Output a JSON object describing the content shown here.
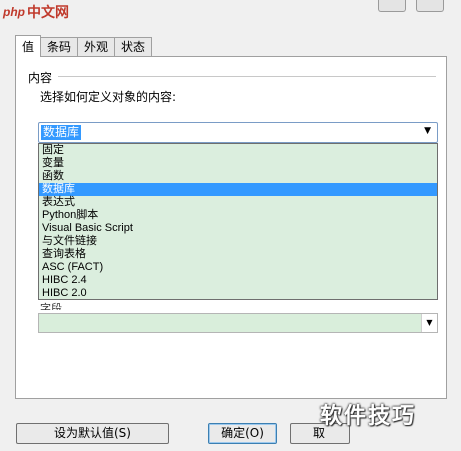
{
  "watermark_top": {
    "php": "php",
    "cn": "中文网"
  },
  "tabs": [
    {
      "label": "值"
    },
    {
      "label": "条码"
    },
    {
      "label": "外观"
    },
    {
      "label": "状态"
    }
  ],
  "content_group": {
    "title": "内容",
    "prompt": "选择如何定义对象的内容:",
    "selected": "数据库"
  },
  "dropdown_options": [
    "固定",
    "变量",
    "函数",
    "数据库",
    "表达式",
    "Python脚本",
    "Visual Basic Script",
    "与文件链接",
    "查询表格",
    "ASC (FACT)",
    "HIBC 2.4",
    "HIBC 2.0"
  ],
  "partial_label": "字段",
  "buttons": {
    "set_default": "设为默认值(S)",
    "ok": "确定(O)",
    "cancel": "取"
  },
  "watermark_bottom": "软件技巧"
}
